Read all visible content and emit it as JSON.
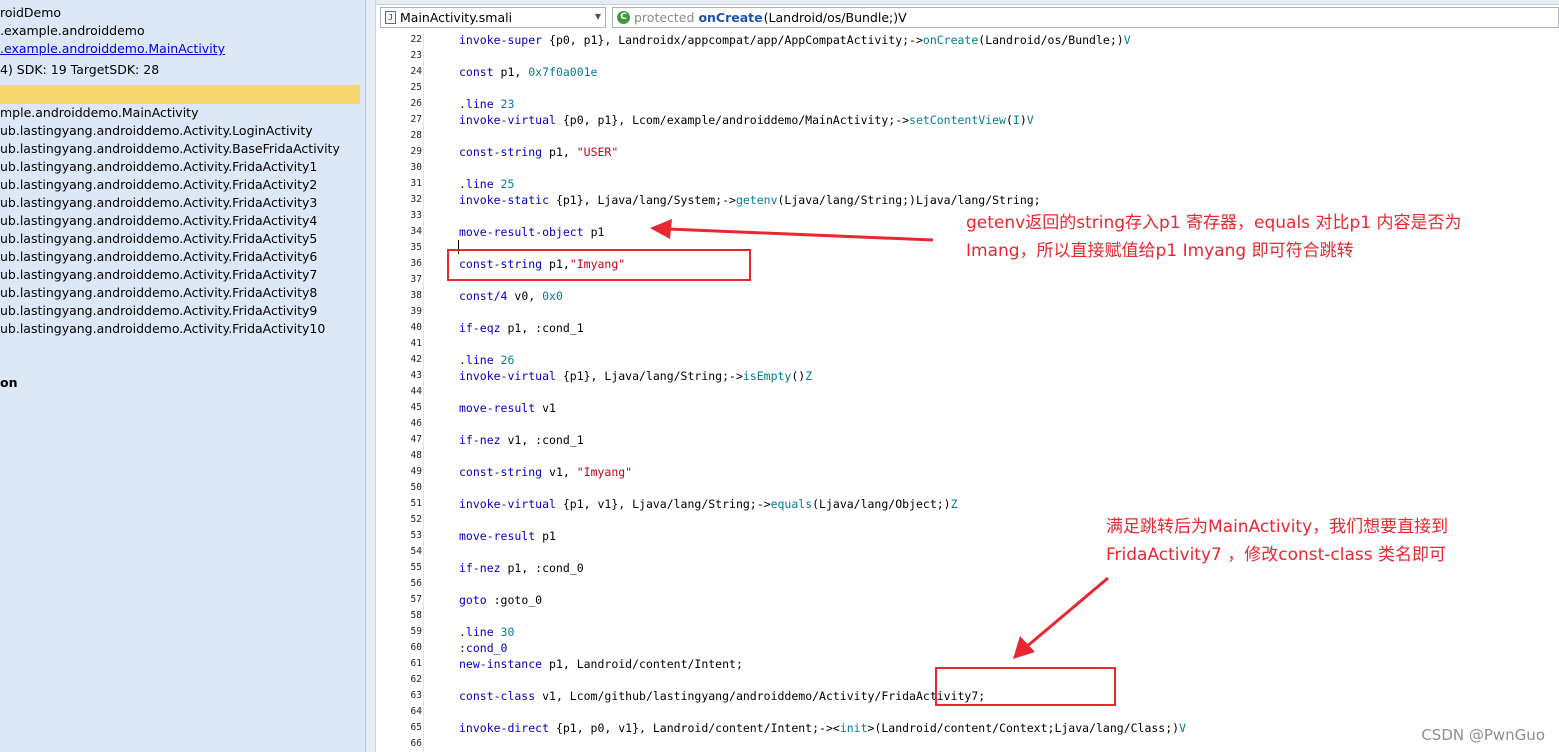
{
  "left_panel": {
    "lines": [
      {
        "text": "roidDemo",
        "style": ""
      },
      {
        "text": ".example.androiddemo",
        "style": ""
      },
      {
        "text": ".example.androiddemo.MainActivity",
        "style": "link"
      },
      {
        "text": "4) SDK:  19 TargetSDK:  28",
        "style": ""
      },
      {
        "text": "mple.androiddemo.MainActivity",
        "style": ""
      },
      {
        "text": "ub.lastingyang.androiddemo.Activity.LoginActivity",
        "style": ""
      },
      {
        "text": "ub.lastingyang.androiddemo.Activity.BaseFridaActivity",
        "style": ""
      },
      {
        "text": "ub.lastingyang.androiddemo.Activity.FridaActivity1",
        "style": ""
      },
      {
        "text": "ub.lastingyang.androiddemo.Activity.FridaActivity2",
        "style": ""
      },
      {
        "text": "ub.lastingyang.androiddemo.Activity.FridaActivity3",
        "style": ""
      },
      {
        "text": "ub.lastingyang.androiddemo.Activity.FridaActivity4",
        "style": ""
      },
      {
        "text": "ub.lastingyang.androiddemo.Activity.FridaActivity5",
        "style": ""
      },
      {
        "text": "ub.lastingyang.androiddemo.Activity.FridaActivity6",
        "style": ""
      },
      {
        "text": "ub.lastingyang.androiddemo.Activity.FridaActivity7",
        "style": ""
      },
      {
        "text": "ub.lastingyang.androiddemo.Activity.FridaActivity8",
        "style": ""
      },
      {
        "text": "ub.lastingyang.androiddemo.Activity.FridaActivity9",
        "style": ""
      },
      {
        "text": "ub.lastingyang.androiddemo.Activity.FridaActivity10",
        "style": ""
      },
      {
        "text": "on",
        "style": "bold"
      }
    ]
  },
  "toolbar": {
    "file_combo": {
      "icon": "java-file-icon",
      "icon_glyph": "J",
      "value": "MainActivity.smali"
    },
    "method_combo": {
      "icon": "method-icon",
      "icon_glyph": "C",
      "modifier": "protected",
      "name": "onCreate",
      "signature": "(Landroid/os/Bundle;)V"
    }
  },
  "editor": {
    "lines": [
      {
        "n": "22",
        "t": [
          [
            "kw",
            "invoke-super "
          ],
          [
            "n",
            "{p0, p1}, Landroidx/appcompat/app/AppCompatActivity;->"
          ],
          [
            "m",
            "onCreate"
          ],
          [
            "n",
            "(Landroid/os/Bundle;)"
          ],
          [
            "m",
            "V"
          ]
        ]
      },
      {
        "n": "23",
        "t": []
      },
      {
        "n": "24",
        "t": [
          [
            "kw",
            "const "
          ],
          [
            "n",
            "p1, "
          ],
          [
            "m",
            "0x7f0a001e"
          ]
        ]
      },
      {
        "n": "25",
        "t": []
      },
      {
        "n": "26",
        "t": [
          [
            "kw",
            ".line "
          ],
          [
            "m",
            "23"
          ]
        ]
      },
      {
        "n": "27",
        "t": [
          [
            "kw",
            "invoke-virtual "
          ],
          [
            "n",
            "{p0, p1}, Lcom/example/androiddemo/MainActivity;->"
          ],
          [
            "m",
            "setContentView"
          ],
          [
            "n",
            "("
          ],
          [
            "m",
            "I"
          ],
          [
            "n",
            ")"
          ],
          [
            "m",
            "V"
          ]
        ]
      },
      {
        "n": "28",
        "t": []
      },
      {
        "n": "29",
        "t": [
          [
            "kw",
            "const-string "
          ],
          [
            "n",
            "p1, "
          ],
          [
            "s",
            "\"USER\""
          ]
        ]
      },
      {
        "n": "30",
        "t": []
      },
      {
        "n": "31",
        "t": [
          [
            "kw",
            ".line "
          ],
          [
            "m",
            "25"
          ]
        ]
      },
      {
        "n": "32",
        "t": [
          [
            "kw",
            "invoke-static "
          ],
          [
            "n",
            "{p1}, Ljava/lang/System;->"
          ],
          [
            "m",
            "getenv"
          ],
          [
            "n",
            "(Ljava/lang/String;)Ljava/lang/String;"
          ]
        ]
      },
      {
        "n": "33",
        "t": []
      },
      {
        "n": "34",
        "t": [
          [
            "kw",
            "move-result-object "
          ],
          [
            "n",
            "p1"
          ]
        ]
      },
      {
        "n": "35",
        "t": []
      },
      {
        "n": "36",
        "t": [
          [
            "kw",
            "const-string "
          ],
          [
            "n",
            "p1,"
          ],
          [
            "s",
            "\"Imyang\""
          ]
        ]
      },
      {
        "n": "37",
        "t": []
      },
      {
        "n": "38",
        "t": [
          [
            "kw",
            "const/4 "
          ],
          [
            "n",
            "v0, "
          ],
          [
            "m",
            "0x0"
          ]
        ]
      },
      {
        "n": "39",
        "t": []
      },
      {
        "n": "40",
        "t": [
          [
            "kw",
            "if-eqz "
          ],
          [
            "n",
            "p1, :cond_1"
          ]
        ]
      },
      {
        "n": "41",
        "t": []
      },
      {
        "n": "42",
        "t": [
          [
            "kw",
            ".line "
          ],
          [
            "m",
            "26"
          ]
        ]
      },
      {
        "n": "43",
        "t": [
          [
            "kw",
            "invoke-virtual "
          ],
          [
            "n",
            "{p1}, Ljava/lang/String;->"
          ],
          [
            "m",
            "isEmpty"
          ],
          [
            "n",
            "()"
          ],
          [
            "m",
            "Z"
          ]
        ]
      },
      {
        "n": "44",
        "t": []
      },
      {
        "n": "45",
        "t": [
          [
            "kw",
            "move-result "
          ],
          [
            "n",
            "v1"
          ]
        ]
      },
      {
        "n": "46",
        "t": []
      },
      {
        "n": "47",
        "t": [
          [
            "kw",
            "if-nez "
          ],
          [
            "n",
            "v1, :cond_1"
          ]
        ]
      },
      {
        "n": "48",
        "t": []
      },
      {
        "n": "49",
        "t": [
          [
            "kw",
            "const-string "
          ],
          [
            "n",
            "v1, "
          ],
          [
            "s",
            "\"Imyang\""
          ]
        ]
      },
      {
        "n": "50",
        "t": []
      },
      {
        "n": "51",
        "t": [
          [
            "kw",
            "invoke-virtual "
          ],
          [
            "n",
            "{p1, v1}, Ljava/lang/String;->"
          ],
          [
            "m",
            "equals"
          ],
          [
            "n",
            "(Ljava/lang/Object;)"
          ],
          [
            "m",
            "Z"
          ]
        ]
      },
      {
        "n": "52",
        "t": []
      },
      {
        "n": "53",
        "t": [
          [
            "kw",
            "move-result "
          ],
          [
            "n",
            "p1"
          ]
        ]
      },
      {
        "n": "54",
        "t": []
      },
      {
        "n": "55",
        "t": [
          [
            "kw",
            "if-nez "
          ],
          [
            "n",
            "p1, :cond_0"
          ]
        ]
      },
      {
        "n": "56",
        "t": []
      },
      {
        "n": "57",
        "t": [
          [
            "kw",
            "goto "
          ],
          [
            "n",
            ":goto_0"
          ]
        ]
      },
      {
        "n": "58",
        "t": []
      },
      {
        "n": "59",
        "t": [
          [
            "kw",
            ".line "
          ],
          [
            "m",
            "30"
          ]
        ]
      },
      {
        "n": "60",
        "t": [
          [
            "kw",
            ":cond_0"
          ]
        ]
      },
      {
        "n": "61",
        "t": [
          [
            "kw",
            "new-instance "
          ],
          [
            "n",
            "p1, Landroid/content/Intent;"
          ]
        ]
      },
      {
        "n": "62",
        "t": []
      },
      {
        "n": "63",
        "t": [
          [
            "kw",
            "const-class "
          ],
          [
            "n",
            "v1, Lcom/github/lastingyang/androiddemo/Activity/FridaActivity7;"
          ]
        ]
      },
      {
        "n": "64",
        "t": []
      },
      {
        "n": "65",
        "t": [
          [
            "kw",
            "invoke-direct "
          ],
          [
            "n",
            "{p1, p0, v1}, Landroid/content/Intent;-><"
          ],
          [
            "m",
            "init"
          ],
          [
            "n",
            ">(Landroid/content/Context;Ljava/lang/Class;)"
          ],
          [
            "m",
            "V"
          ]
        ]
      },
      {
        "n": "66",
        "t": []
      }
    ]
  },
  "annotations": {
    "note1": [
      "getenv返回的string存入p1 寄存器，equals 对比p1 内容是否为",
      "Imang，所以直接赋值给p1 Imyang 即可符合跳转"
    ],
    "note2": [
      "满足跳转后为MainActivity，我们想要直接到",
      "FridaActivity7 ，修改const-class 类名即可"
    ],
    "color": "#e8282e"
  },
  "watermark": "CSDN @PwnGuo"
}
